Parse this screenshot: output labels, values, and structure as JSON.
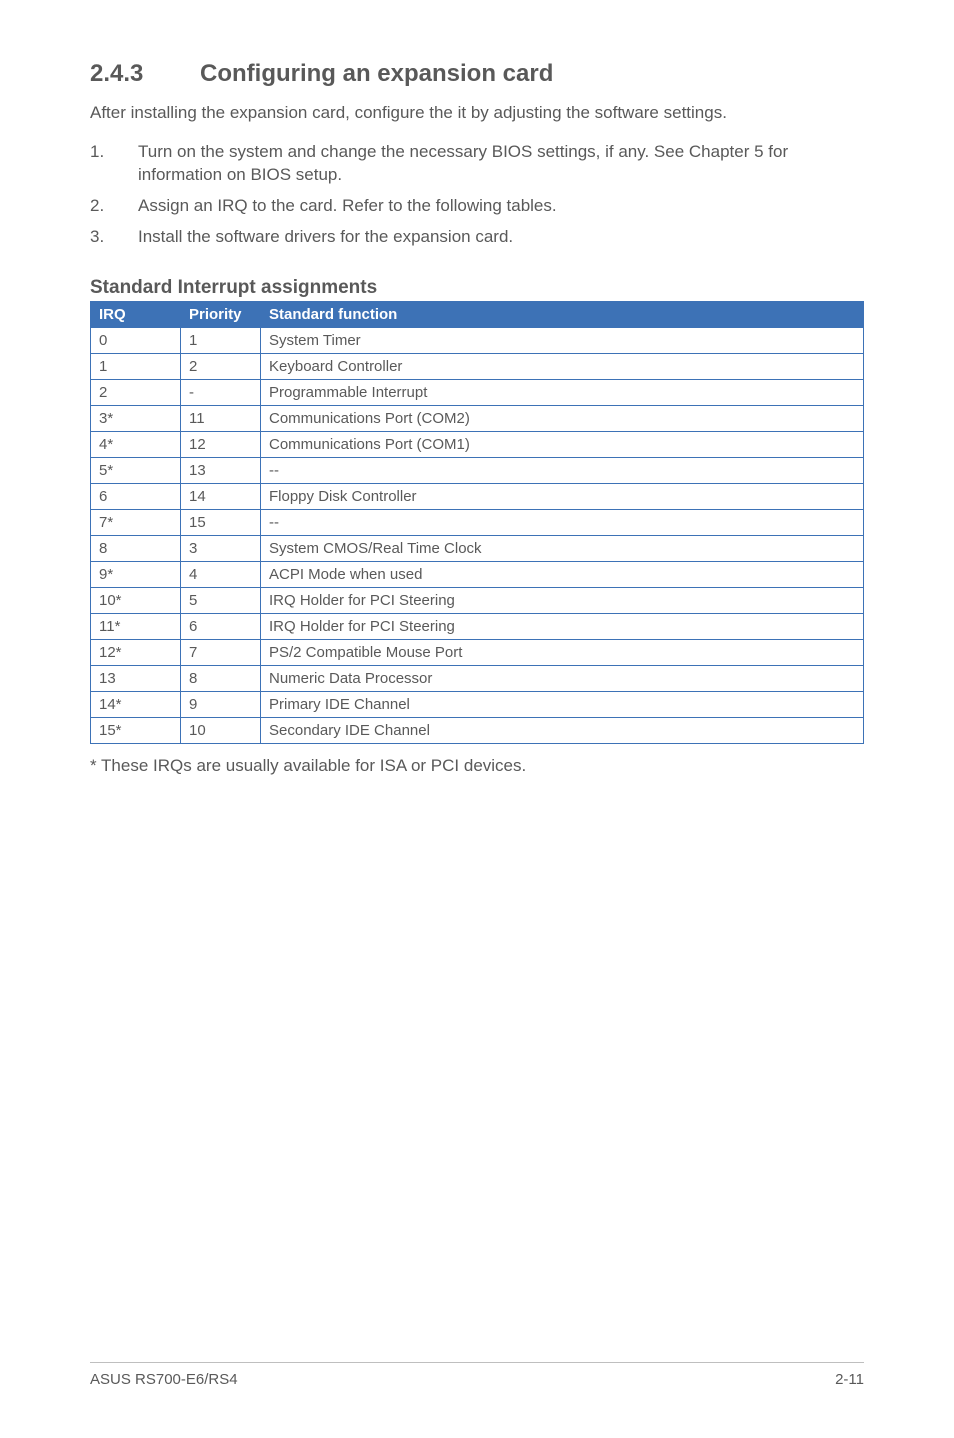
{
  "heading": {
    "number": "2.4.3",
    "title": "Configuring an expansion card"
  },
  "intro": "After installing the expansion card, configure the it by adjusting the software settings.",
  "steps": [
    {
      "n": "1.",
      "text": "Turn on the system and change the necessary BIOS settings, if any. See Chapter 5 for information on BIOS setup."
    },
    {
      "n": "2.",
      "text": "Assign an IRQ to the card. Refer to the following tables."
    },
    {
      "n": "3.",
      "text": "Install the software drivers for the expansion card."
    }
  ],
  "table_title": "Standard Interrupt assignments",
  "table": {
    "headers": {
      "irq": "IRQ",
      "priority": "Priority",
      "func": "Standard function"
    },
    "rows": [
      {
        "irq": "0",
        "priority": "1",
        "func": "System Timer"
      },
      {
        "irq": "1",
        "priority": "2",
        "func": "Keyboard Controller"
      },
      {
        "irq": "2",
        "priority": "-",
        "func": "Programmable Interrupt"
      },
      {
        "irq": "3*",
        "priority": "11",
        "func": "Communications Port (COM2)"
      },
      {
        "irq": "4*",
        "priority": "12",
        "func": "Communications Port (COM1)"
      },
      {
        "irq": "5*",
        "priority": "13",
        "func": "--"
      },
      {
        "irq": "6",
        "priority": "14",
        "func": "Floppy Disk Controller"
      },
      {
        "irq": "7*",
        "priority": "15",
        "func": "--"
      },
      {
        "irq": "8",
        "priority": "3",
        "func": "System CMOS/Real Time Clock"
      },
      {
        "irq": "9*",
        "priority": "4",
        "func": "ACPI Mode when used"
      },
      {
        "irq": "10*",
        "priority": "5",
        "func": "IRQ Holder for PCI Steering"
      },
      {
        "irq": "11*",
        "priority": "6",
        "func": "IRQ Holder for PCI Steering"
      },
      {
        "irq": "12*",
        "priority": "7",
        "func": "PS/2 Compatible Mouse Port"
      },
      {
        "irq": "13",
        "priority": "8",
        "func": "Numeric Data Processor"
      },
      {
        "irq": "14*",
        "priority": "9",
        "func": "Primary IDE Channel"
      },
      {
        "irq": "15*",
        "priority": "10",
        "func": "Secondary IDE Channel"
      }
    ]
  },
  "footnote": "* These IRQs are usually available for ISA or PCI devices.",
  "footer": {
    "left": "ASUS RS700-E6/RS4",
    "right": "2-11"
  }
}
